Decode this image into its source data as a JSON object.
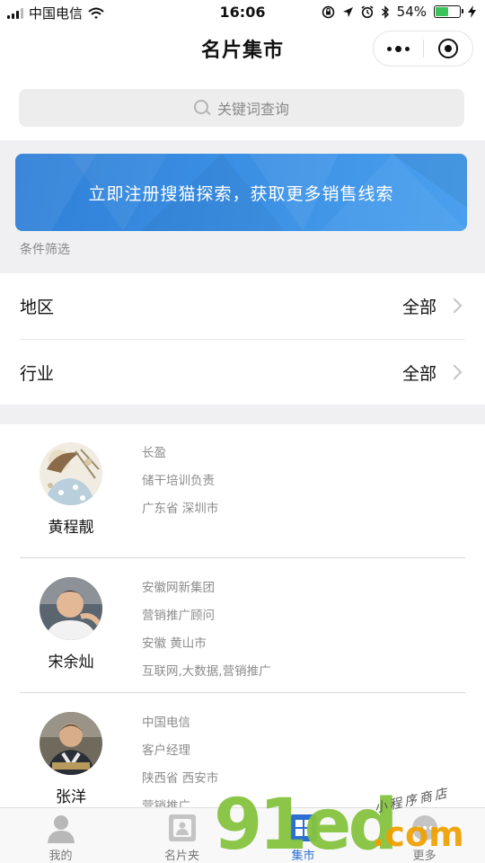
{
  "status_bar": {
    "carrier": "中国电信",
    "time": "16:06",
    "battery_percent": "54%",
    "battery_level": 0.54
  },
  "nav": {
    "title": "名片集市"
  },
  "search": {
    "placeholder": "关键词查询"
  },
  "banner": {
    "text": "立即注册搜猫探索，获取更多销售线索"
  },
  "filter_section": {
    "label": "条件筛选",
    "rows": [
      {
        "label": "地区",
        "value": "全部"
      },
      {
        "label": "行业",
        "value": "全部"
      }
    ]
  },
  "cards": [
    {
      "name": "黄程靓",
      "lines": [
        "长盈",
        "储干培训负责",
        "广东省 深圳市"
      ]
    },
    {
      "name": "宋余灿",
      "lines": [
        "安徽网新集团",
        "营销推广顾问",
        "安徽 黄山市",
        "互联网,大数据,营销推广"
      ]
    },
    {
      "name": "张洋",
      "lines": [
        "中国电信",
        "客户经理",
        "陕西省 西安市",
        "营销推广"
      ]
    }
  ],
  "tabs": [
    {
      "label": "我的",
      "icon": "person-icon"
    },
    {
      "label": "名片夹",
      "icon": "card-folder-icon"
    },
    {
      "label": "集市",
      "icon": "market-icon"
    },
    {
      "label": "更多",
      "icon": "more-icon"
    }
  ],
  "watermark": {
    "main": "91ed",
    "suffix": ".com",
    "tagline": "小程序商店"
  },
  "colors": {
    "accent": "#2d6fd1",
    "banner": "#3a8ee3",
    "watermark_green": "#86c440",
    "watermark_orange": "#f0a000"
  }
}
